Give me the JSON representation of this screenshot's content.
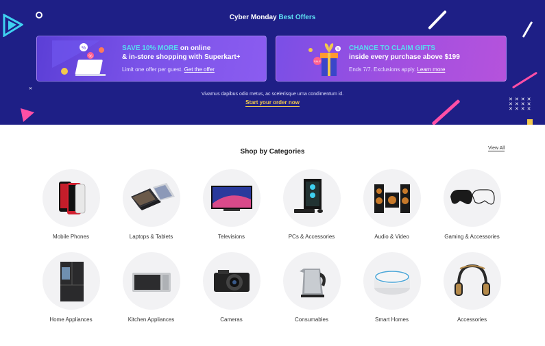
{
  "hero": {
    "title_prefix": "Cyber Monday",
    "title_accent": "Best Offers",
    "note": "Vivamus dapibus odio metus, ac scelerisque urna condimentum id.",
    "cta": "Start your order now",
    "colors": {
      "background": "#1e1f86",
      "accent": "#5ee0f2",
      "cta": "#f2c94c",
      "pink": "#ff4fa6"
    }
  },
  "promos": [
    {
      "highlight": "SAVE 10% MORE",
      "head_rest": "on online",
      "head_line2": "& in-store shopping with Superkart+",
      "sub_text": "Limit one offer per guest.",
      "link": "Get the offer",
      "icon": "laptop-discount-icon"
    },
    {
      "highlight": "CHANCE TO CLAIM GIFTS",
      "head_line2": "inside every purchase above $199",
      "sub_text": "Ends 7/7. Exclusions apply.",
      "link": "Learn more",
      "icon": "gift-box-icon"
    }
  ],
  "categories_section": {
    "title": "Shop by Categories",
    "view_all": "View All"
  },
  "categories": [
    {
      "label": "Mobile Phones",
      "icon": "phone-icon"
    },
    {
      "label": "Laptops & Tablets",
      "icon": "laptop-icon"
    },
    {
      "label": "Televisions",
      "icon": "tv-icon"
    },
    {
      "label": "PCs & Accessories",
      "icon": "pc-icon"
    },
    {
      "label": "Audio & Video",
      "icon": "speaker-icon"
    },
    {
      "label": "Gaming & Accessories",
      "icon": "gamepad-icon"
    },
    {
      "label": "Home Appliances",
      "icon": "fridge-icon"
    },
    {
      "label": "Kitchen Appliances",
      "icon": "microwave-icon"
    },
    {
      "label": "Cameras",
      "icon": "camera-icon"
    },
    {
      "label": "Consumables",
      "icon": "kettle-icon"
    },
    {
      "label": "Smart Homes",
      "icon": "smart-speaker-icon"
    },
    {
      "label": "Accessories",
      "icon": "headphones-icon"
    }
  ]
}
